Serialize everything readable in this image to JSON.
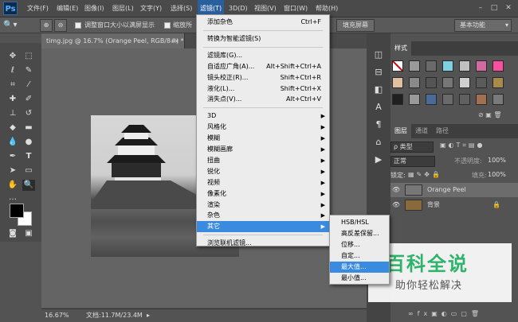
{
  "app": {
    "logo": "Ps"
  },
  "menubar": {
    "items": [
      "文件(F)",
      "编辑(E)",
      "图像(I)",
      "图层(L)",
      "文字(Y)",
      "选择(S)",
      "滤镜(T)",
      "3D(D)",
      "视图(V)",
      "窗口(W)",
      "帮助(H)"
    ],
    "active": "滤镜(T)",
    "window_buttons": [
      "–",
      "□",
      "✕"
    ]
  },
  "options_bar": {
    "checkbox1_label": "调整窗口大小以满屏显示",
    "checkbox2_label": "缩放所",
    "fill_screen_button": "填充屏幕",
    "workspace": "基本功能"
  },
  "document": {
    "tab_title": "timg.jpg @ 16.7% (Orange Peel, RGB/8#) *",
    "tab_close": "×",
    "zoom": "16.67%",
    "doc_info": "文档:11.7M/23.4M"
  },
  "filter_menu": {
    "items": [
      {
        "label": "添加杂色",
        "shortcut": "Ctrl+F"
      },
      {
        "sep": true
      },
      {
        "label": "转换为智能滤镜(S)"
      },
      {
        "sep": true
      },
      {
        "label": "滤镜库(G)..."
      },
      {
        "label": "自适应广角(A)...",
        "shortcut": "Alt+Shift+Ctrl+A"
      },
      {
        "label": "镜头校正(R)...",
        "shortcut": "Shift+Ctrl+R"
      },
      {
        "label": "液化(L)...",
        "shortcut": "Shift+Ctrl+X"
      },
      {
        "label": "消失点(V)...",
        "shortcut": "Alt+Ctrl+V"
      },
      {
        "sep": true
      },
      {
        "label": "3D",
        "submenu": true
      },
      {
        "label": "风格化",
        "submenu": true
      },
      {
        "label": "模糊",
        "submenu": true
      },
      {
        "label": "模糊画廊",
        "submenu": true
      },
      {
        "label": "扭曲",
        "submenu": true
      },
      {
        "label": "锐化",
        "submenu": true
      },
      {
        "label": "视频",
        "submenu": true
      },
      {
        "label": "像素化",
        "submenu": true
      },
      {
        "label": "渲染",
        "submenu": true
      },
      {
        "label": "杂色",
        "submenu": true
      },
      {
        "label": "其它",
        "submenu": true,
        "highlighted": true
      },
      {
        "sep": true
      },
      {
        "label": "浏览联机滤镜..."
      }
    ]
  },
  "other_submenu": {
    "items": [
      "HSB/HSL",
      "高反差保留...",
      "位移...",
      "自定...",
      "最大值...",
      "最小值..."
    ],
    "highlighted": "最大值..."
  },
  "styles_panel": {
    "tab": "样式",
    "swatches": [
      "#ffffff",
      "#9a9a9a",
      "#6a6a6a",
      "#7fd0e0",
      "#c0c0c0",
      "#d06aa0",
      "#ff4fa0",
      "#e0c0a0",
      "#8a8a8a",
      "#555555",
      "#777777",
      "#d0d0d0",
      "#5a5a5a",
      "#a88a4a",
      "#202020",
      "#999999",
      "#4a6a9a",
      "#6a6a6a",
      "#606060",
      "#a07050",
      "#7a7a7a"
    ]
  },
  "layers_panel": {
    "tabs": [
      "图层",
      "通道",
      "路径"
    ],
    "filter_label": "ρ 类型",
    "blend_mode": "正常",
    "opacity_label": "不透明度:",
    "opacity": "100%",
    "lock_label": "锁定:",
    "fill_label": "填充:",
    "fill": "100%",
    "layers": [
      {
        "name": "Orange Peel",
        "selected": true
      },
      {
        "name": "背景",
        "selected": false
      }
    ]
  },
  "watermark": {
    "title": "百科全说",
    "subtitle": "助你轻松解决"
  },
  "colors": {
    "accent": "#3a8be0",
    "panel": "#535353",
    "menu_bg": "#ececec"
  }
}
